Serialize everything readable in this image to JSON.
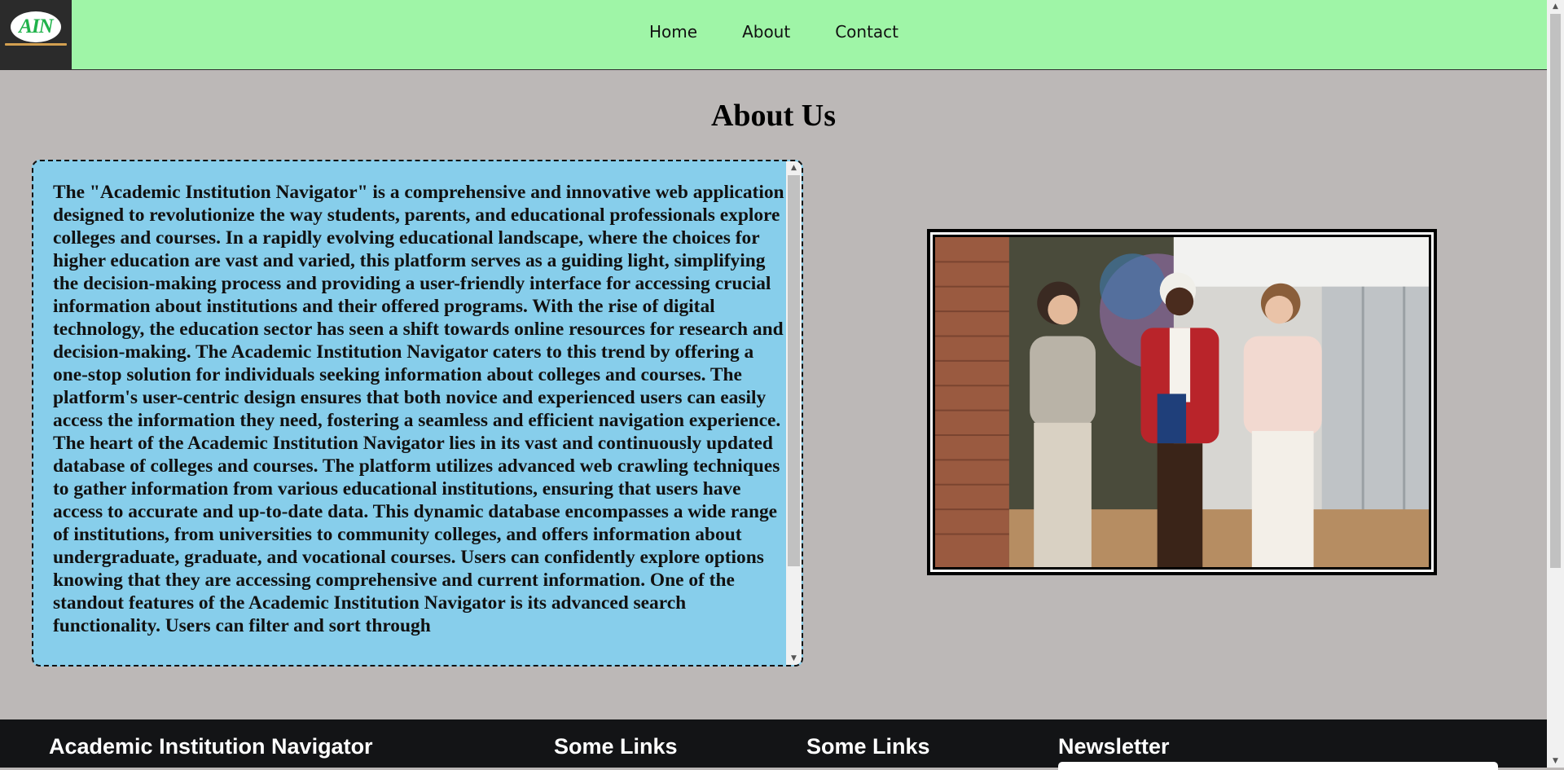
{
  "header": {
    "logo_text": "AIN",
    "nav": [
      "Home",
      "About",
      "Contact"
    ]
  },
  "main": {
    "title": "About Us",
    "about_text": "The \"Academic Institution Navigator\" is a comprehensive and innovative web application designed to revolutionize the way students, parents, and educational professionals explore colleges and courses. In a rapidly evolving educational landscape, where the choices for higher education are vast and varied, this platform serves as a guiding light, simplifying the decision-making process and providing a user-friendly interface for accessing crucial information about institutions and their offered programs. With the rise of digital technology, the education sector has seen a shift towards online resources for research and decision-making. The Academic Institution Navigator caters to this trend by offering a one-stop solution for individuals seeking information about colleges and courses. The platform's user-centric design ensures that both novice and experienced users can easily access the information they need, fostering a seamless and efficient navigation experience. The heart of the Academic Institution Navigator lies in its vast and continuously updated database of colleges and courses. The platform utilizes advanced web crawling techniques to gather information from various educational institutions, ensuring that users have access to accurate and up-to-date data. This dynamic database encompasses a wide range of institutions, from universities to community colleges, and offers information about undergraduate, graduate, and vocational courses. Users can confidently explore options knowing that they are accessing comprehensive and current information. One of the standout features of the Academic Institution Navigator is its advanced search functionality. Users can filter and sort through"
  },
  "footer": {
    "brand": "Academic Institution Navigator",
    "links_heading_1": "Some Links",
    "links_heading_2": "Some Links",
    "newsletter_heading": "Newsletter"
  },
  "colors": {
    "header_bg": "#9ff5a7",
    "page_bg": "#bcb8b7",
    "about_box_bg": "#87ceeb",
    "footer_bg": "#131416"
  }
}
